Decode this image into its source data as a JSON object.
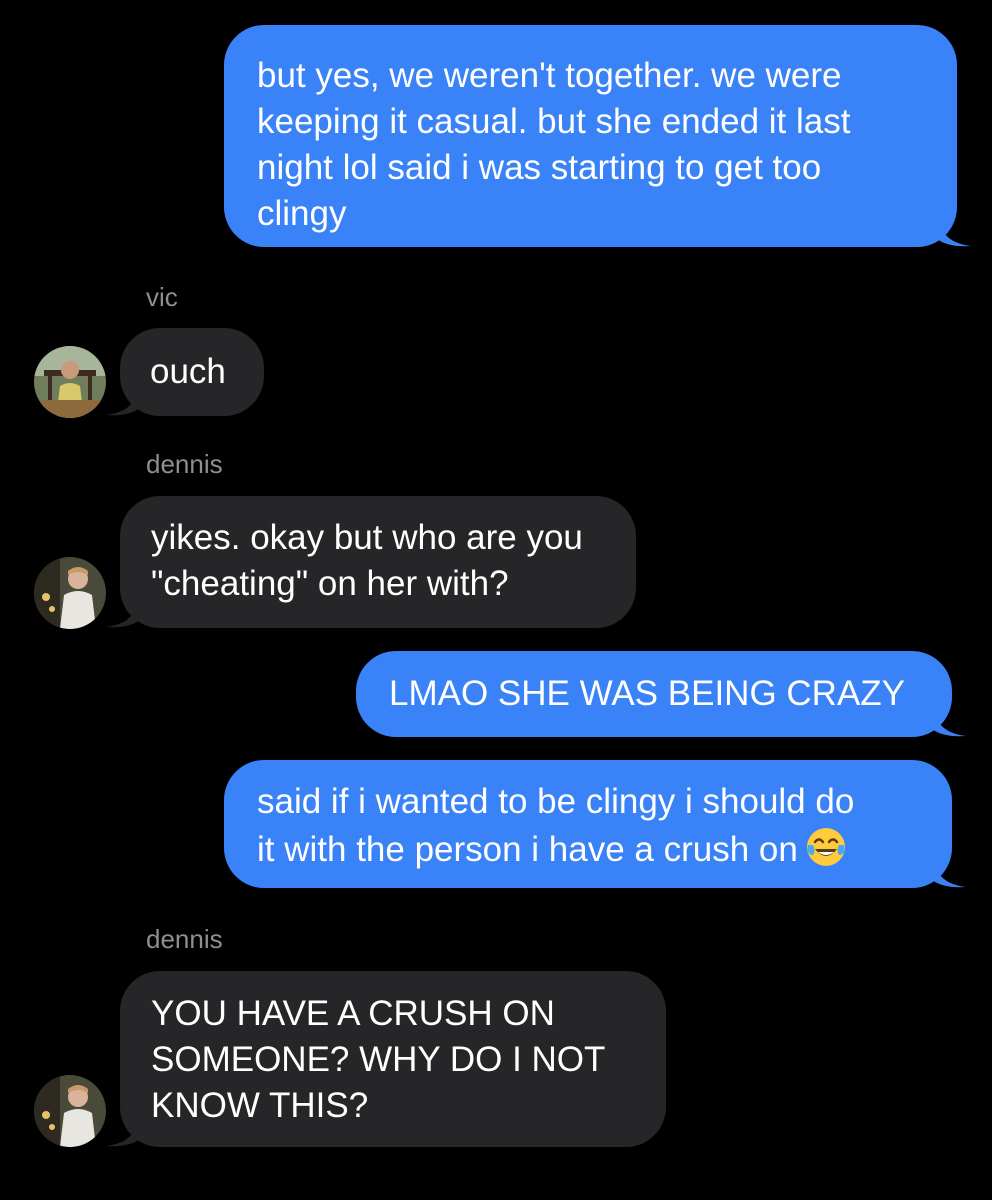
{
  "colors": {
    "background": "#000000",
    "outgoing_bubble": "#3a82f7",
    "incoming_bubble": "#262629",
    "sender_name": "#8e8e93",
    "text": "#ffffff"
  },
  "messages": [
    {
      "direction": "outgoing",
      "text": "but yes, we weren't together. we were\nkeeping it casual. but she ended it last\nnight lol said i was starting to get too\nclingy"
    },
    {
      "direction": "incoming",
      "sender": "vic",
      "avatar": "vic-avatar",
      "text": "ouch"
    },
    {
      "direction": "incoming",
      "sender": "dennis",
      "avatar": "dennis-avatar",
      "text": "yikes. okay but who are you\n\"cheating\" on her with?"
    },
    {
      "direction": "outgoing",
      "text": "LMAO SHE WAS BEING CRAZY"
    },
    {
      "direction": "outgoing",
      "text": "said if i wanted to be clingy i should do\nit with the person i have a crush on",
      "emoji": "tears-of-joy-emoji"
    },
    {
      "direction": "incoming",
      "sender": "dennis",
      "avatar": "dennis-avatar",
      "text": "YOU HAVE A CRUSH ON\nSOMEONE? WHY DO I NOT\nKNOW THIS?"
    }
  ]
}
